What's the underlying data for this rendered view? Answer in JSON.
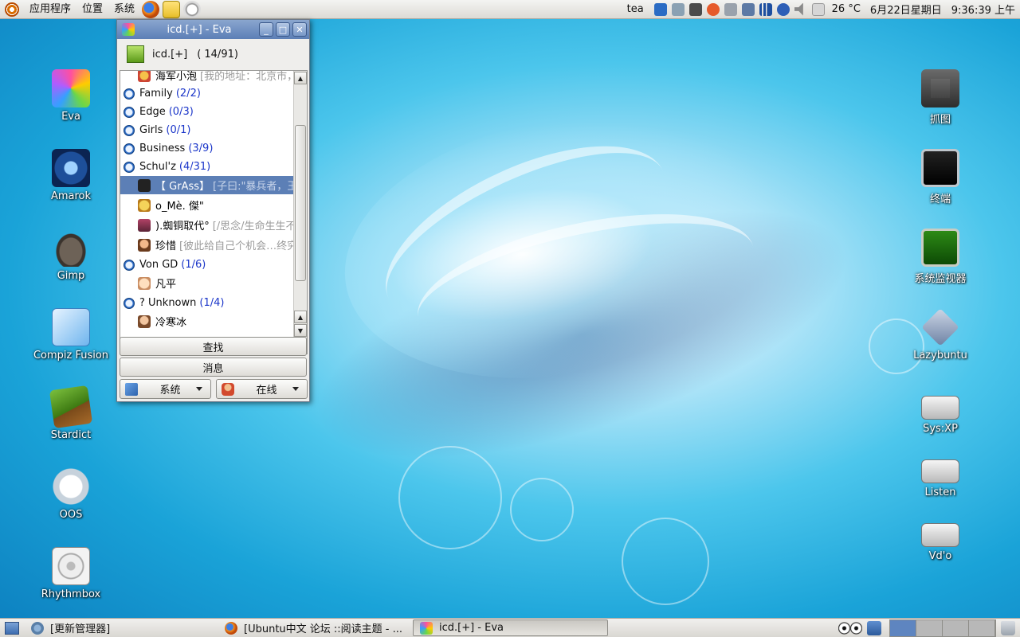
{
  "top_panel": {
    "menus": [
      "应用程序",
      "位置",
      "系统"
    ],
    "launchers": [
      "firefox-icon",
      "notes-icon",
      "clock-app-icon"
    ],
    "user": "tea",
    "temperature": "26 °C",
    "date": "6月22日星期日",
    "time": "9:36:39 上午"
  },
  "desktop_left": [
    {
      "label": "Eva",
      "icon": "eva-icon"
    },
    {
      "label": "Amarok",
      "icon": "amarok-icon"
    },
    {
      "label": "Gimp",
      "icon": "gimp-icon"
    },
    {
      "label": "Compiz Fusion",
      "icon": "compiz-icon"
    },
    {
      "label": "Stardict",
      "icon": "stardict-icon"
    },
    {
      "label": "OOS",
      "icon": "openoffice-icon"
    },
    {
      "label": "Rhythmbox",
      "icon": "rhythmbox-icon"
    }
  ],
  "desktop_right": [
    {
      "label": "抓图",
      "icon": "camera-icon"
    },
    {
      "label": "终端",
      "icon": "terminal-icon"
    },
    {
      "label": "系统监视器",
      "icon": "system-monitor-icon"
    },
    {
      "label": "Lazybuntu",
      "icon": "lazybuntu-icon"
    },
    {
      "label": "Sys:XP",
      "icon": "drive-icon"
    },
    {
      "label": "Listen",
      "icon": "drive-icon"
    },
    {
      "label": "Vd'o",
      "icon": "drive-icon"
    }
  ],
  "eva": {
    "title": "icd.[+] - Eva",
    "nickname": "icd.[+]",
    "online_count": "( 14/91)",
    "partial_row": {
      "name": "海军小泡",
      "signature": "[我的地址：北京市，"
    },
    "groups": [
      {
        "name": "Family",
        "count": "(2/2)"
      },
      {
        "name": "Edge",
        "count": "(0/3)"
      },
      {
        "name": "Girls",
        "count": "(0/1)"
      },
      {
        "name": "Business",
        "count": "(3/9)"
      },
      {
        "name": "Schul'z",
        "count": "(4/31)"
      },
      {
        "name": "Von GD",
        "count": "(1/6)"
      },
      {
        "name": "? Unknown",
        "count": "(1/4)"
      }
    ],
    "buddies": [
      {
        "name": "【 GrAss】",
        "signature": "[子曰:\"暴兵者，王"
      },
      {
        "name": "o_Mè. 傑\"",
        "signature": ""
      },
      {
        "name": ").蜘铜取代°",
        "signature": "[/思念/生命生生不"
      },
      {
        "name": "珍惜",
        "signature": "[彼此给自己个机会…终究"
      },
      {
        "name": "凡平",
        "signature": ""
      },
      {
        "name": "冷寒冰",
        "signature": ""
      }
    ],
    "find_button": "查找",
    "message_button": "消息",
    "system_combo": "系统",
    "status_combo": "在线"
  },
  "taskbar": {
    "tasks": [
      {
        "label": "[更新管理器]",
        "icon": "update-manager-icon"
      },
      {
        "label": "[Ubuntu中文 论坛 ::阅读主题 - ...",
        "icon": "firefox-icon"
      },
      {
        "label": "icd.[+] - Eva",
        "icon": "eva-icon"
      }
    ]
  },
  "colors": {
    "accent": "#5c7fb6",
    "group_count": "#1a35c9"
  }
}
